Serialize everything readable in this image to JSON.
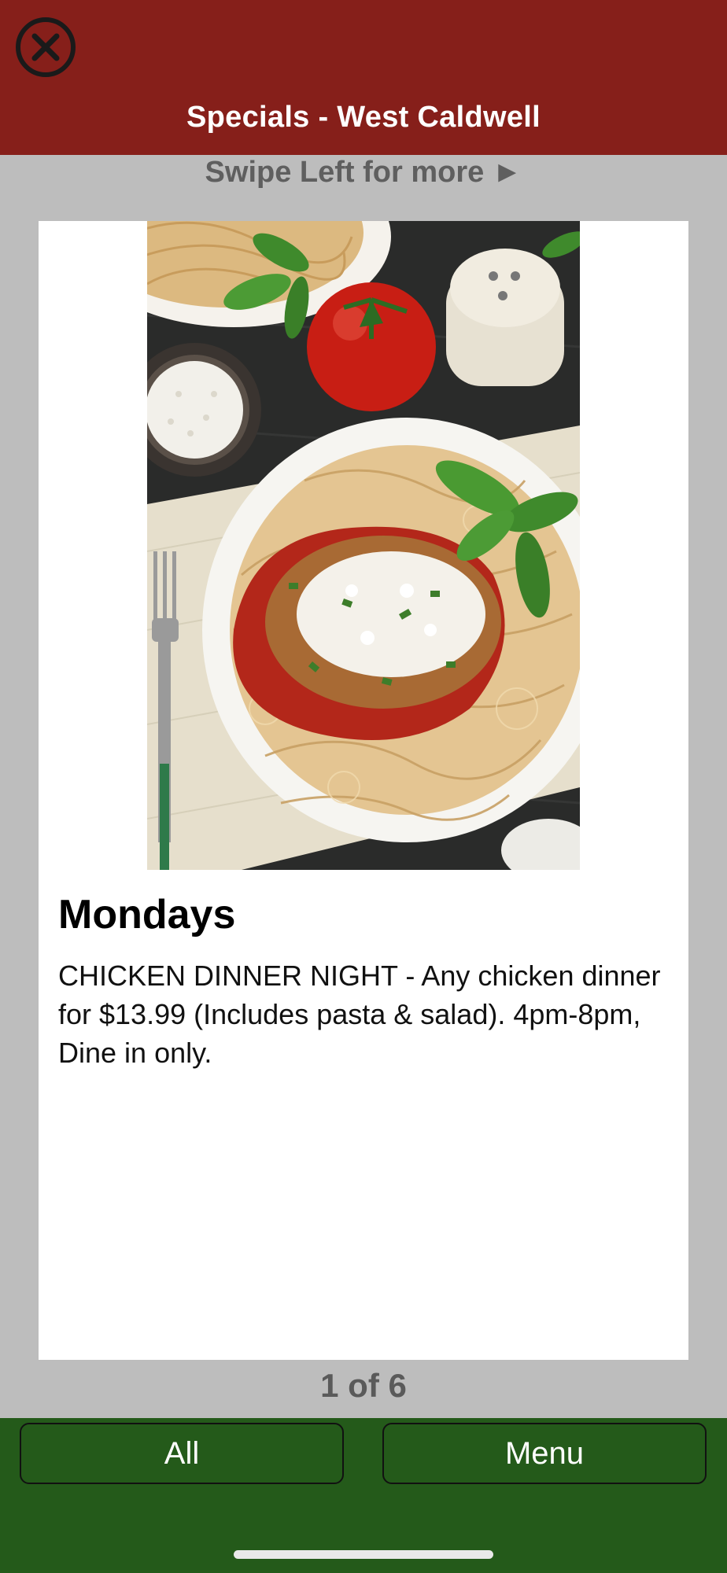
{
  "header": {
    "title": "Specials - West Caldwell",
    "close_icon": "close-circle-icon"
  },
  "swipe_hint": "Swipe Left for more ►",
  "special": {
    "image_description_icon": "chicken-parmesan-photo",
    "day": "Mondays",
    "description": "CHICKEN DINNER NIGHT - Any chicken dinner for $13.99 (Includes pasta & salad). 4pm-8pm, Dine in only."
  },
  "pager": {
    "text": "1 of 6",
    "current": 1,
    "total": 6
  },
  "footer": {
    "all_label": "All",
    "menu_label": "Menu"
  },
  "colors": {
    "header_bg": "#861f1a",
    "footer_bg": "#245a1a",
    "page_bg": "#bdbdbd"
  }
}
